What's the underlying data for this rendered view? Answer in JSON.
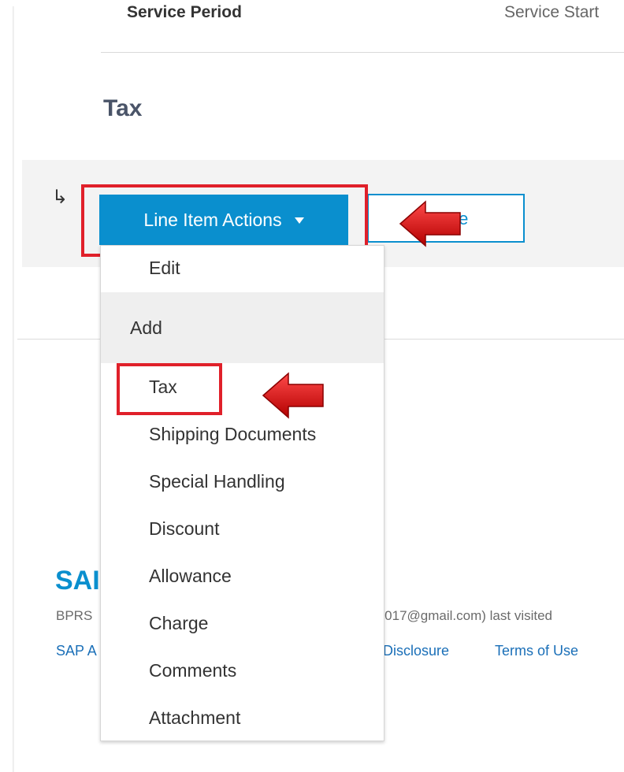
{
  "header": {
    "service_period_label": "Service Period",
    "service_start_label": "Service Start"
  },
  "section": {
    "title": "Tax"
  },
  "actions": {
    "corner_arrow_glyph": "↳",
    "line_item_actions_label": "Line Item Actions",
    "secondary_button_label": "te"
  },
  "dropdown": {
    "edit_label": "Edit",
    "group_label": "Add",
    "items": [
      "Tax",
      "Shipping Documents",
      "Special Handling",
      "Discount",
      "Allowance",
      "Charge",
      "Comments",
      "Attachment"
    ]
  },
  "footer": {
    "logo_text": "SAI",
    "user_text": "BPRS",
    "email_text": ".2017@gmail.com) last visited",
    "link_sap": "SAP A",
    "link_disclosure": "Disclosure",
    "link_terms": "Terms of Use"
  },
  "colors": {
    "accent_blue": "#0a8fce",
    "highlight_red": "#e0202a",
    "heading_color": "#4a5468"
  },
  "icons": {
    "caret": "caret-down-icon",
    "pointer_arrow": "red-left-arrow-icon"
  }
}
